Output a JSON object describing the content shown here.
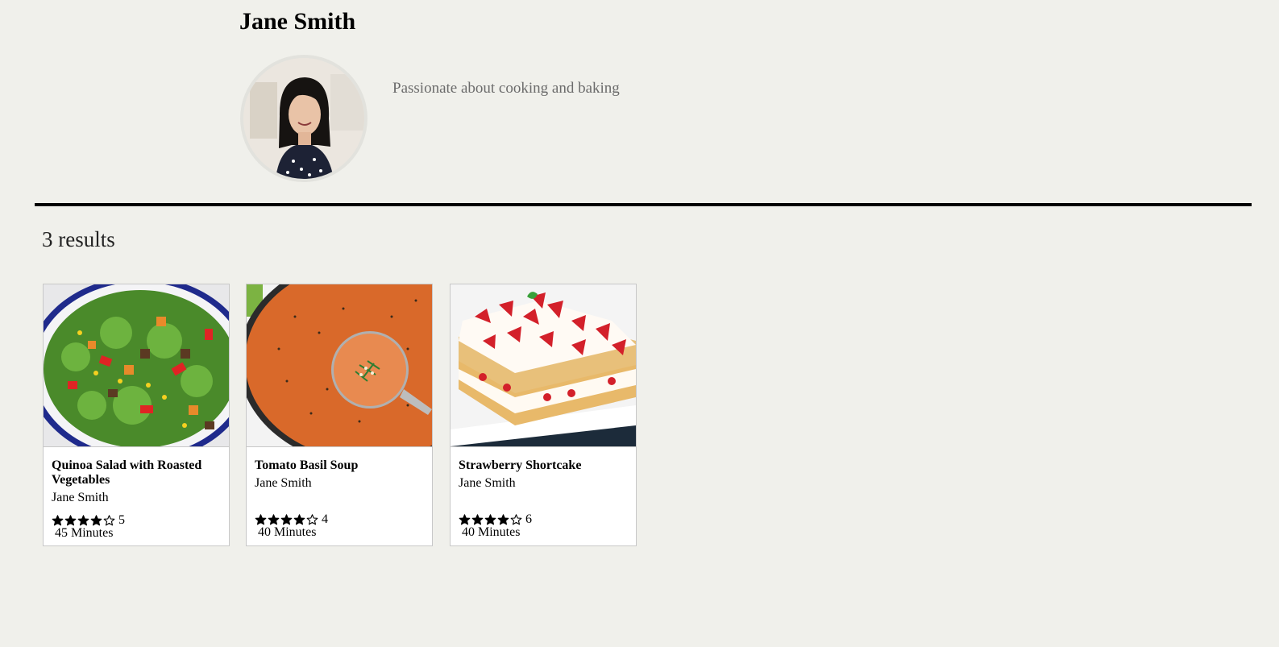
{
  "profile": {
    "name": "Jane Smith",
    "bio": "Passionate about cooking and baking",
    "avatar_icon": "avatar-photo"
  },
  "results": {
    "count_label": "3 results"
  },
  "recipes": [
    {
      "title": "Quinoa Salad with Roasted Vegetables",
      "author": "Jane Smith",
      "rating_stars": 4,
      "rating_max": 5,
      "rating_count": "5",
      "time": "45 Minutes",
      "image_icon": "salad-photo"
    },
    {
      "title": "Tomato Basil Soup",
      "author": "Jane Smith",
      "rating_stars": 4,
      "rating_max": 5,
      "rating_count": "4",
      "time": "40 Minutes",
      "image_icon": "soup-photo"
    },
    {
      "title": "Strawberry Shortcake",
      "author": "Jane Smith",
      "rating_stars": 4,
      "rating_max": 5,
      "rating_count": "6",
      "time": "40 Minutes",
      "image_icon": "cake-photo"
    }
  ],
  "colors": {
    "background": "#f0f0eb",
    "card": "#ffffff",
    "divider": "#000000",
    "bio_text": "#6b6b6b"
  }
}
